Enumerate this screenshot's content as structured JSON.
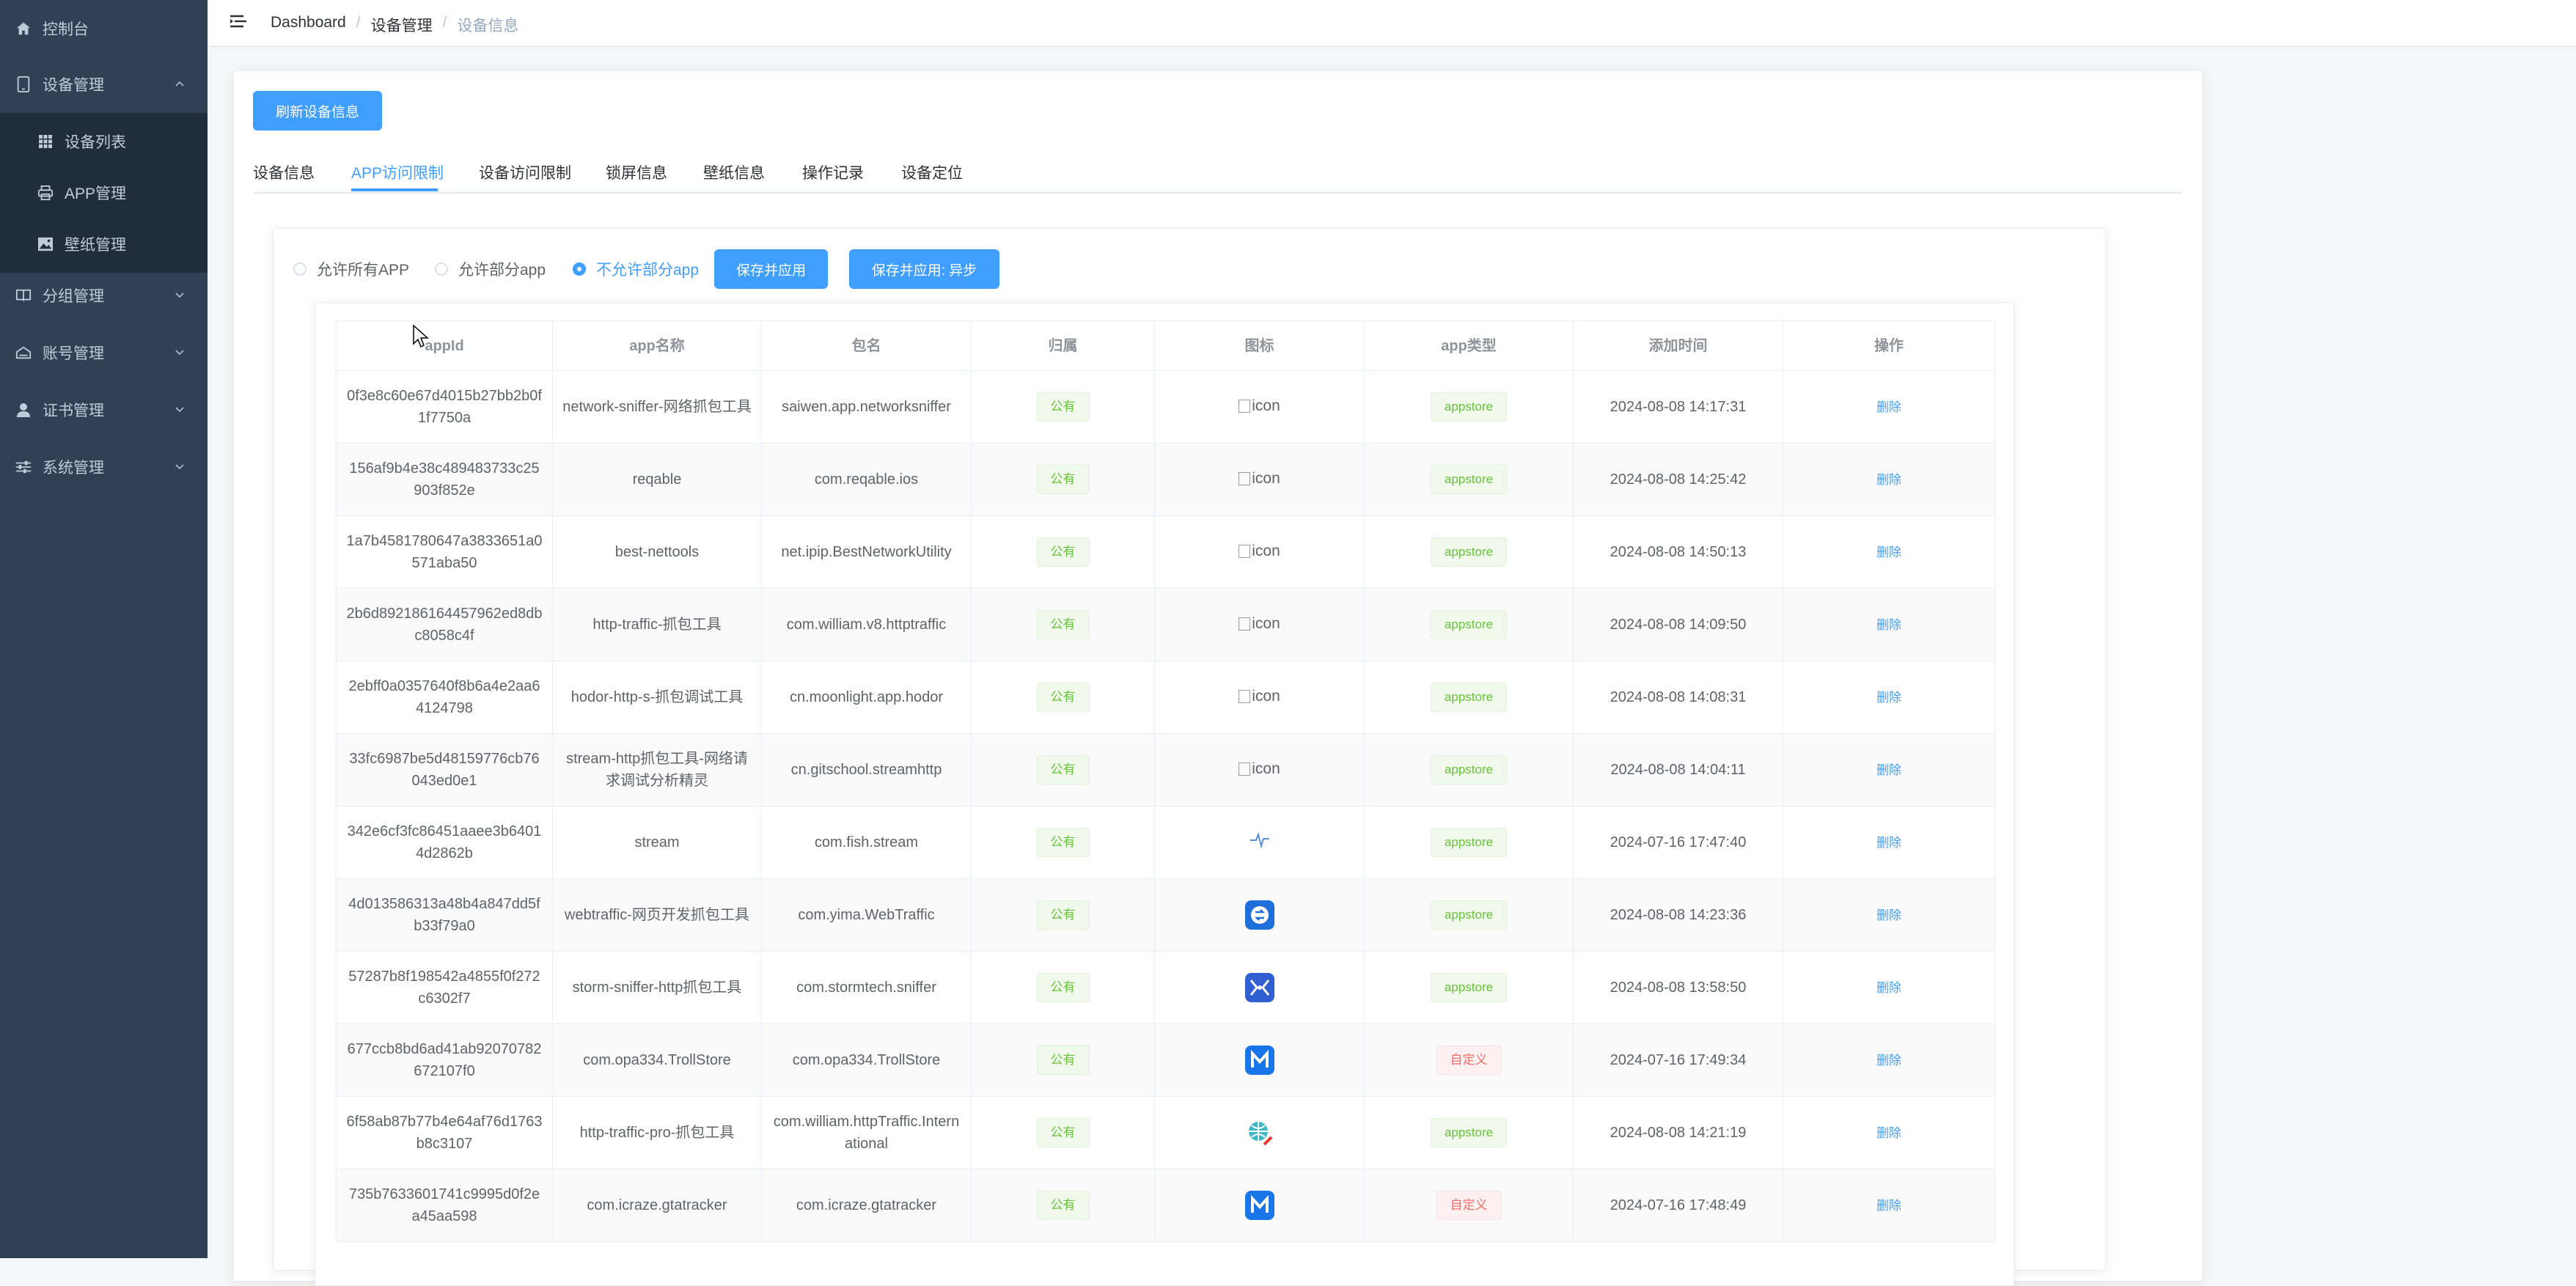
{
  "sidebar": {
    "items": [
      {
        "label": "控制台",
        "icon": "home-icon"
      },
      {
        "label": "设备管理",
        "icon": "tablet-icon"
      },
      {
        "label": "设备列表",
        "icon": "grid-icon"
      },
      {
        "label": "APP管理",
        "icon": "printer-icon"
      },
      {
        "label": "壁纸管理",
        "icon": "picture-icon"
      },
      {
        "label": "分组管理",
        "icon": "book-icon"
      },
      {
        "label": "账号管理",
        "icon": "house-icon"
      },
      {
        "label": "证书管理",
        "icon": "user-icon"
      },
      {
        "label": "系统管理",
        "icon": "sliders-icon"
      }
    ]
  },
  "breadcrumb": {
    "home": "Dashboard",
    "section": "设备管理",
    "current": "设备信息",
    "sep": "/"
  },
  "toolbar": {
    "refresh_label": "刷新设备信息"
  },
  "tabs": [
    "设备信息",
    "APP访问限制",
    "设备访问限制",
    "锁屏信息",
    "壁纸信息",
    "操作记录",
    "设备定位"
  ],
  "active_tab": "APP访问限制",
  "mode": {
    "options": [
      "允许所有APP",
      "允许部分app",
      "不允许部分app"
    ],
    "selected": "不允许部分app"
  },
  "actions": {
    "save_apply": "保存并应用",
    "save_apply_async": "保存并应用: 异步"
  },
  "table": {
    "headers": [
      "appId",
      "app名称",
      "包名",
      "归属",
      "图标",
      "app类型",
      "添加时间",
      "操作"
    ],
    "icon_alt": "icon",
    "delete_label": "删除",
    "rows": [
      {
        "appId": "0f3e8c60e67d4015b27bb2b0f1f7750a",
        "name": "network-sniffer-网络抓包工具",
        "package": "saiwen.app.networksniffer",
        "owner": "公有",
        "icon": "broken",
        "type": "appstore",
        "time": "2024-08-08 14:17:31"
      },
      {
        "appId": "156af9b4e38c489483733c25903f852e",
        "name": "reqable",
        "package": "com.reqable.ios",
        "owner": "公有",
        "icon": "broken",
        "type": "appstore",
        "time": "2024-08-08 14:25:42"
      },
      {
        "appId": "1a7b4581780647a3833651a0571aba50",
        "name": "best-nettools",
        "package": "net.ipip.BestNetworkUtility",
        "owner": "公有",
        "icon": "broken",
        "type": "appstore",
        "time": "2024-08-08 14:50:13"
      },
      {
        "appId": "2b6d892186164457962ed8dbc8058c4f",
        "name": "http-traffic-抓包工具",
        "package": "com.william.v8.httptraffic",
        "owner": "公有",
        "icon": "broken",
        "type": "appstore",
        "time": "2024-08-08 14:09:50"
      },
      {
        "appId": "2ebff0a0357640f8b6a4e2aa64124798",
        "name": "hodor-http-s-抓包调试工具",
        "package": "cn.moonlight.app.hodor",
        "owner": "公有",
        "icon": "broken",
        "type": "appstore",
        "time": "2024-08-08 14:08:31"
      },
      {
        "appId": "33fc6987be5d48159776cb76043ed0e1",
        "name": "stream-http抓包工具-网络请求调试分析精灵",
        "package": "cn.gitschool.streamhttp",
        "owner": "公有",
        "icon": "broken",
        "type": "appstore",
        "time": "2024-08-08 14:04:11"
      },
      {
        "appId": "342e6cf3fc86451aaee3b64014d2862b",
        "name": "stream",
        "package": "com.fish.stream",
        "owner": "公有",
        "icon": "pulse",
        "type": "appstore",
        "time": "2024-07-16 17:47:40"
      },
      {
        "appId": "4d013586313a48b4a847dd5fb33f79a0",
        "name": "webtraffic-网页开发抓包工具",
        "package": "com.yima.WebTraffic",
        "owner": "公有",
        "icon": "webtraffic",
        "type": "appstore",
        "time": "2024-08-08 14:23:36"
      },
      {
        "appId": "57287b8f198542a4855f0f272c6302f7",
        "name": "storm-sniffer-http抓包工具",
        "package": "com.stormtech.sniffer",
        "owner": "公有",
        "icon": "storm",
        "type": "appstore",
        "time": "2024-08-08 13:58:50"
      },
      {
        "appId": "677ccb8bd6ad41ab92070782672107f0",
        "name": "com.opa334.TrollStore",
        "package": "com.opa334.TrollStore",
        "owner": "公有",
        "icon": "m-logo",
        "type": "自定义",
        "time": "2024-07-16 17:49:34"
      },
      {
        "appId": "6f58ab87b77b4e64af76d1763b8c3107",
        "name": "http-traffic-pro-抓包工具",
        "package": "com.william.httpTraffic.International",
        "owner": "公有",
        "icon": "globe",
        "type": "appstore",
        "time": "2024-08-08 14:21:19"
      },
      {
        "appId": "735b7633601741c9995d0f2ea45aa598",
        "name": "com.icraze.gtatracker",
        "package": "com.icraze.gtatracker",
        "owner": "公有",
        "icon": "m-logo",
        "type": "自定义",
        "time": "2024-07-16 17:48:49"
      }
    ]
  },
  "colors": {
    "primary": "#409eff",
    "sidebar_bg": "#304156",
    "success": "#67c23a",
    "danger": "#f56c6c"
  }
}
